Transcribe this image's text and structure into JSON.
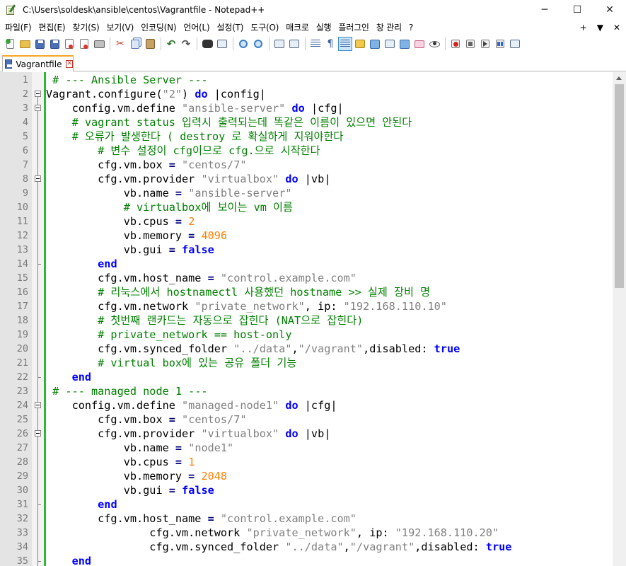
{
  "window": {
    "title": "C:\\Users\\soldesk\\ansible\\centos\\Vagrantfile - Notepad++",
    "minimize_label": "─",
    "maximize_label": "☐",
    "close_label": "✕"
  },
  "menu": {
    "items": [
      "파일(F)",
      "편집(E)",
      "찾기(S)",
      "보기(V)",
      "인코딩(N)",
      "언어(L)",
      "설정(T)",
      "도구(O)",
      "매크로",
      "실행",
      "플러그인",
      "창 관리",
      "?"
    ],
    "right_plus": "+",
    "right_down": "▼",
    "right_close": "✕"
  },
  "tab": {
    "label": "Vagrantfile",
    "close_label": "✕"
  },
  "colors": {
    "comment": "#008000",
    "keyword": "#0000ff",
    "string": "#808080",
    "number": "#ff8000",
    "changebar": "#2fb82f",
    "tab_accent": "#f5a623"
  },
  "editor": {
    "lines": [
      {
        "n": "1",
        "fold": "none",
        "tokens": [
          [
            " ",
            "id"
          ],
          [
            "# --- Ansible Server ---",
            "cm"
          ]
        ]
      },
      {
        "n": "2",
        "fold": "open",
        "tokens": [
          [
            "Vagrant.configure(",
            "id"
          ],
          [
            "\"2\"",
            "str"
          ],
          [
            ") ",
            "id"
          ],
          [
            "do",
            "kw"
          ],
          [
            " |config|",
            "id"
          ]
        ]
      },
      {
        "n": "3",
        "fold": "open",
        "tokens": [
          [
            "    config.vm.define ",
            "id"
          ],
          [
            "\"ansible-server\"",
            "str"
          ],
          [
            " ",
            "id"
          ],
          [
            "do",
            "kw"
          ],
          [
            " |cfg|",
            "id"
          ]
        ]
      },
      {
        "n": "4",
        "fold": "line",
        "tokens": [
          [
            "    # vagrant status 입력시 출력되는데 똑같은 이름이 있으면 안된다",
            "cm"
          ]
        ]
      },
      {
        "n": "5",
        "fold": "line",
        "tokens": [
          [
            "    # 오류가 발생한다 ( destroy 로 확실하게 지워야한다",
            "cm"
          ]
        ]
      },
      {
        "n": "6",
        "fold": "line",
        "tokens": [
          [
            "        # 변수 설정이 cfg이므로 cfg.으로 시작한다",
            "cm"
          ]
        ]
      },
      {
        "n": "7",
        "fold": "line",
        "tokens": [
          [
            "        cfg.vm.box ",
            "id"
          ],
          [
            "=",
            "op"
          ],
          [
            " ",
            "id"
          ],
          [
            "\"centos/7\"",
            "str"
          ]
        ]
      },
      {
        "n": "8",
        "fold": "open",
        "tokens": [
          [
            "        cfg.vm.provider ",
            "id"
          ],
          [
            "\"virtualbox\"",
            "str"
          ],
          [
            " ",
            "id"
          ],
          [
            "do",
            "kw"
          ],
          [
            " |vb|",
            "id"
          ]
        ]
      },
      {
        "n": "9",
        "fold": "line",
        "tokens": [
          [
            "            vb.name ",
            "id"
          ],
          [
            "=",
            "op"
          ],
          [
            " ",
            "id"
          ],
          [
            "\"ansible-server\"",
            "str"
          ]
        ]
      },
      {
        "n": "10",
        "fold": "line",
        "tokens": [
          [
            "            # virtualbox에 보이는 vm 이름",
            "cm"
          ]
        ]
      },
      {
        "n": "11",
        "fold": "line",
        "tokens": [
          [
            "            vb.cpus ",
            "id"
          ],
          [
            "=",
            "op"
          ],
          [
            " ",
            "id"
          ],
          [
            "2",
            "num"
          ]
        ]
      },
      {
        "n": "12",
        "fold": "line",
        "tokens": [
          [
            "            vb.memory ",
            "id"
          ],
          [
            "=",
            "op"
          ],
          [
            " ",
            "id"
          ],
          [
            "4096",
            "num"
          ]
        ]
      },
      {
        "n": "13",
        "fold": "line",
        "tokens": [
          [
            "            vb.gui ",
            "id"
          ],
          [
            "=",
            "op"
          ],
          [
            " ",
            "id"
          ],
          [
            "false",
            "kw"
          ]
        ]
      },
      {
        "n": "14",
        "fold": "end",
        "tokens": [
          [
            "        ",
            "id"
          ],
          [
            "end",
            "kw"
          ]
        ]
      },
      {
        "n": "15",
        "fold": "line",
        "tokens": [
          [
            "        cfg.vm.host_name ",
            "id"
          ],
          [
            "=",
            "op"
          ],
          [
            " ",
            "id"
          ],
          [
            "\"control.example.com\"",
            "str"
          ]
        ]
      },
      {
        "n": "16",
        "fold": "line",
        "tokens": [
          [
            "        # 리눅스에서 hostnamectl 사용했던 hostname >> 실제 장비 명",
            "cm"
          ]
        ]
      },
      {
        "n": "17",
        "fold": "line",
        "tokens": [
          [
            "        cfg.vm.network ",
            "id"
          ],
          [
            "\"private_network\"",
            "str"
          ],
          [
            ", ip: ",
            "id"
          ],
          [
            "\"192.168.110.10\"",
            "str"
          ]
        ]
      },
      {
        "n": "18",
        "fold": "line",
        "tokens": [
          [
            "        # 첫번째 랜카드는 자동으로 잡힌다 (NAT으로 잡힌다)",
            "cm"
          ]
        ]
      },
      {
        "n": "19",
        "fold": "line",
        "tokens": [
          [
            "        # private_network == host-only",
            "cm"
          ]
        ]
      },
      {
        "n": "20",
        "fold": "line",
        "tokens": [
          [
            "        cfg.vm.synced_folder ",
            "id"
          ],
          [
            "\"../data\"",
            "str"
          ],
          [
            ",",
            "id"
          ],
          [
            "\"/vagrant\"",
            "str"
          ],
          [
            ",disabled: ",
            "id"
          ],
          [
            "true",
            "kw"
          ]
        ]
      },
      {
        "n": "21",
        "fold": "line",
        "tokens": [
          [
            "        # virtual box에 있는 공유 폴더 기능",
            "cm"
          ]
        ]
      },
      {
        "n": "22",
        "fold": "end",
        "tokens": [
          [
            "    ",
            "id"
          ],
          [
            "end",
            "kw"
          ]
        ]
      },
      {
        "n": "23",
        "fold": "line",
        "tokens": [
          [
            " ",
            "id"
          ],
          [
            "# --- managed node 1 ---",
            "cm"
          ]
        ]
      },
      {
        "n": "24",
        "fold": "open",
        "tokens": [
          [
            "    config.vm.define ",
            "id"
          ],
          [
            "\"managed-node1\"",
            "str"
          ],
          [
            " ",
            "id"
          ],
          [
            "do",
            "kw"
          ],
          [
            " |cfg|",
            "id"
          ]
        ]
      },
      {
        "n": "25",
        "fold": "line",
        "tokens": [
          [
            "        cfg.vm.box ",
            "id"
          ],
          [
            "=",
            "op"
          ],
          [
            " ",
            "id"
          ],
          [
            "\"centos/7\"",
            "str"
          ]
        ]
      },
      {
        "n": "26",
        "fold": "open",
        "tokens": [
          [
            "        cfg.vm.provider ",
            "id"
          ],
          [
            "\"virtualbox\"",
            "str"
          ],
          [
            " ",
            "id"
          ],
          [
            "do",
            "kw"
          ],
          [
            " |vb|",
            "id"
          ]
        ]
      },
      {
        "n": "27",
        "fold": "line",
        "tokens": [
          [
            "            vb.name ",
            "id"
          ],
          [
            "=",
            "op"
          ],
          [
            " ",
            "id"
          ],
          [
            "\"node1\"",
            "str"
          ]
        ]
      },
      {
        "n": "28",
        "fold": "line",
        "tokens": [
          [
            "            vb.cpus ",
            "id"
          ],
          [
            "=",
            "op"
          ],
          [
            " ",
            "id"
          ],
          [
            "1",
            "num"
          ]
        ]
      },
      {
        "n": "29",
        "fold": "line",
        "tokens": [
          [
            "            vb.memory ",
            "id"
          ],
          [
            "=",
            "op"
          ],
          [
            " ",
            "id"
          ],
          [
            "2048",
            "num"
          ]
        ]
      },
      {
        "n": "30",
        "fold": "line",
        "tokens": [
          [
            "            vb.gui ",
            "id"
          ],
          [
            "=",
            "op"
          ],
          [
            " ",
            "id"
          ],
          [
            "false",
            "kw"
          ]
        ]
      },
      {
        "n": "31",
        "fold": "end",
        "tokens": [
          [
            "        ",
            "id"
          ],
          [
            "end",
            "kw"
          ]
        ]
      },
      {
        "n": "32",
        "fold": "line",
        "tokens": [
          [
            "        cfg.vm.host_name ",
            "id"
          ],
          [
            "=",
            "op"
          ],
          [
            " ",
            "id"
          ],
          [
            "\"control.example.com\"",
            "str"
          ]
        ]
      },
      {
        "n": "33",
        "fold": "line",
        "tokens": [
          [
            "                cfg.vm.network ",
            "id"
          ],
          [
            "\"private_network\"",
            "str"
          ],
          [
            ", ip: ",
            "id"
          ],
          [
            "\"192.168.110.20\"",
            "str"
          ]
        ]
      },
      {
        "n": "34",
        "fold": "line",
        "tokens": [
          [
            "                cfg.vm.synced_folder ",
            "id"
          ],
          [
            "\"../data\"",
            "str"
          ],
          [
            ",",
            "id"
          ],
          [
            "\"/vagrant\"",
            "str"
          ],
          [
            ",disabled: ",
            "id"
          ],
          [
            "true",
            "kw"
          ]
        ]
      },
      {
        "n": "35",
        "fold": "end",
        "tokens": [
          [
            "    ",
            "id"
          ],
          [
            "end",
            "kw"
          ]
        ]
      }
    ]
  }
}
